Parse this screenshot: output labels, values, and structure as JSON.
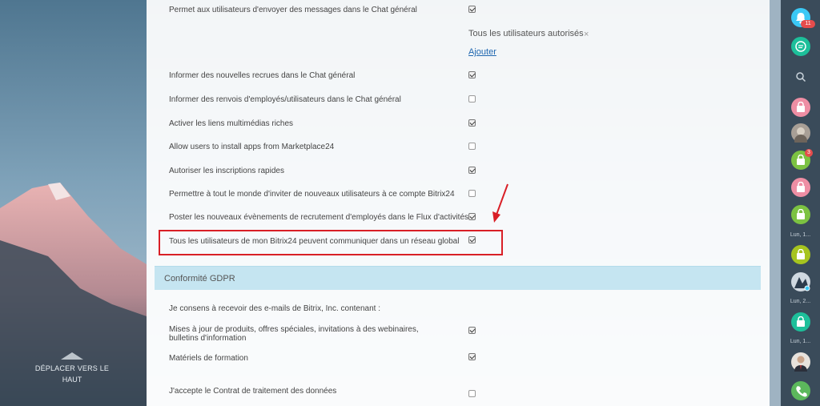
{
  "settings": {
    "rows": [
      {
        "label": "Permet aux utilisateurs d'envoyer des messages dans le Chat général",
        "checked": true
      },
      {
        "label": "Informer des nouvelles recrues dans le Chat général",
        "checked": true
      },
      {
        "label": "Informer des renvois d'employés/utilisateurs dans le Chat général",
        "checked": false
      },
      {
        "label": "Activer les liens multimédias riches",
        "checked": true
      },
      {
        "label": "Allow users to install apps from Marketplace24",
        "checked": false
      },
      {
        "label": "Autoriser les inscriptions rapides",
        "checked": true
      },
      {
        "label": "Permettre à tout le monde d'inviter de nouveaux utilisateurs à ce compte Bitrix24",
        "checked": false
      },
      {
        "label": "Poster les nouveaux évènements de recrutement d'employés dans le Flux d'activités",
        "checked": true
      },
      {
        "label": "Tous les utilisateurs de mon Bitrix24 peuvent communiquer dans un réseau global",
        "checked": true
      }
    ],
    "allowed_tag": "Tous les utilisateurs autorisés",
    "remove_tag_glyph": "×",
    "add_link": "Ajouter"
  },
  "gdpr": {
    "title": "Conformité GDPR",
    "consent_intro": "Je consens à recevoir des e-mails de Bitrix, Inc. contenant :",
    "items": [
      {
        "label_line1": "Mises à jour de produits, offres spéciales, invitations à des webinaires,",
        "label_line2": "bulletins d'information",
        "checked": true
      },
      {
        "label_line1": "Matériels de formation",
        "label_line2": "",
        "checked": true
      }
    ],
    "agreement": {
      "label": "J'accepte le Contrat de traitement des données",
      "checked": false
    }
  },
  "left": {
    "move_up_line1": "DÉPLACER VERS LE",
    "move_up_line2": "HAUT"
  },
  "sidebar": {
    "notifications_badge": "11",
    "contact_badge": "3",
    "time_labels": [
      "Lun, 1...",
      "Lun, 2...",
      "Lun, 1..."
    ]
  },
  "colors": {
    "highlight": "#d91f26",
    "gdpr_header": "#c5e5f1",
    "link": "#2067b0",
    "sidebar_bg": "#3a4b5a",
    "green": "#7cc242",
    "pink": "#ee8ea4",
    "teal": "#1dbf9a",
    "bell_blue": "#3bc8f5"
  }
}
